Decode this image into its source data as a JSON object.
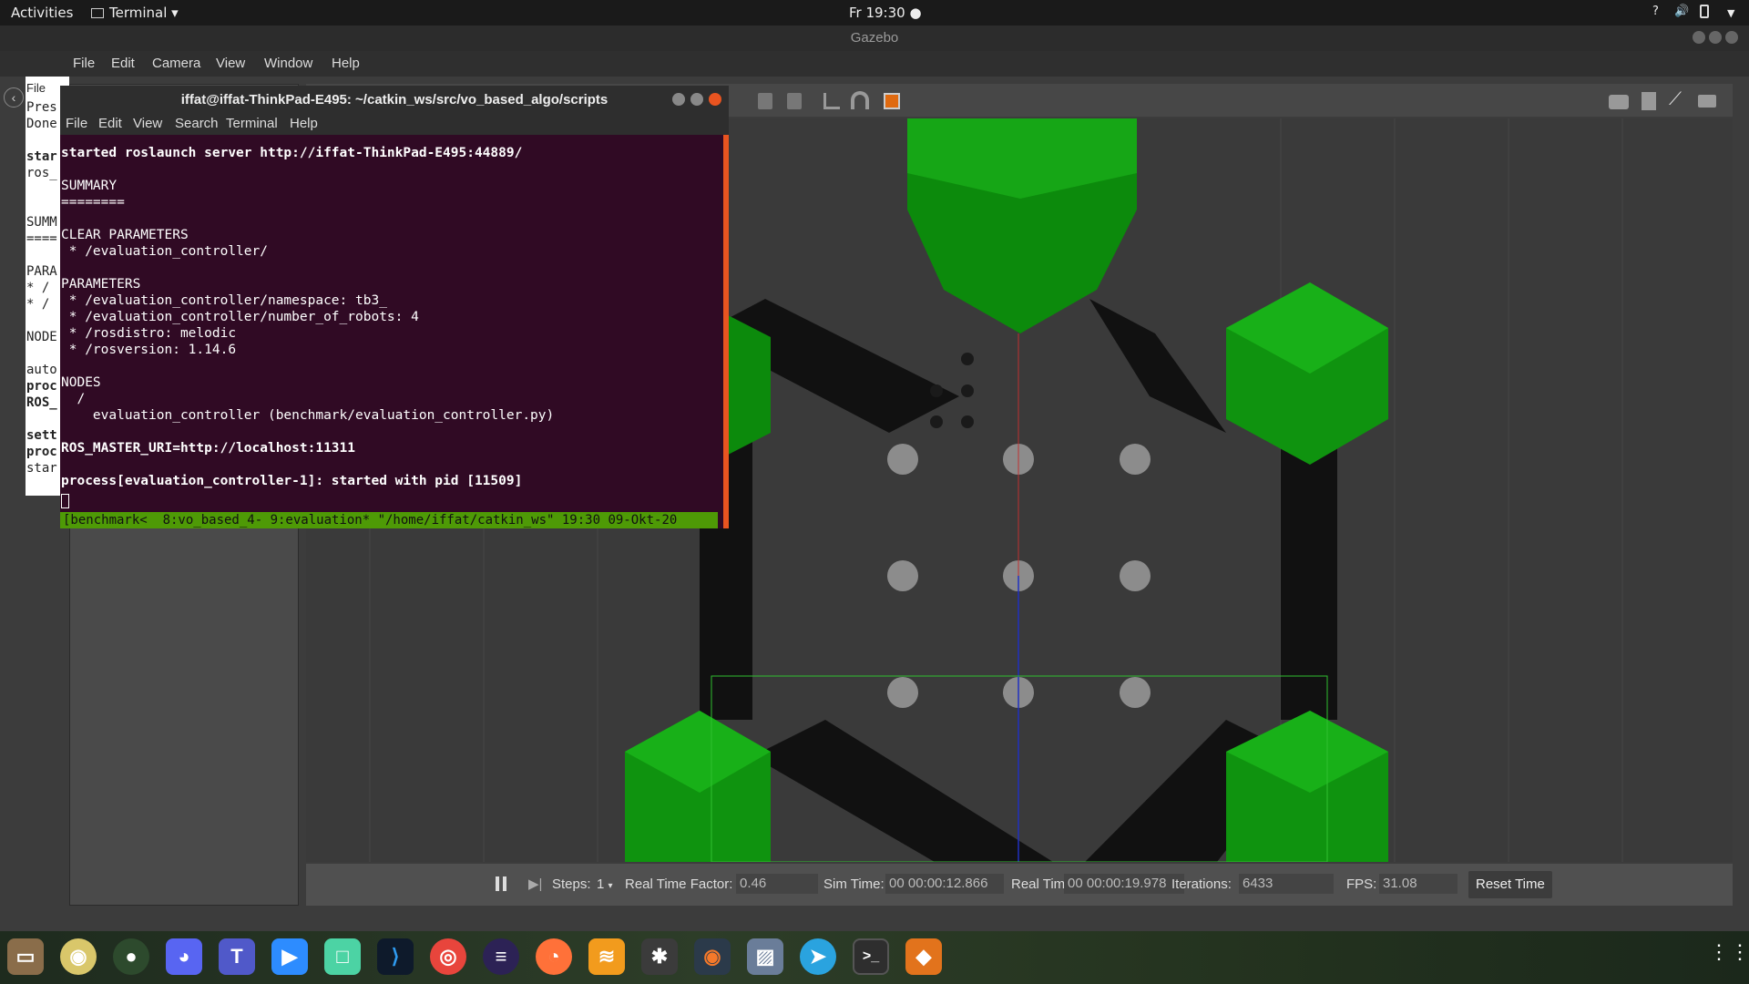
{
  "topbar": {
    "activities": "Activities",
    "app_menu": "Terminal",
    "clock": "Fr 19:30",
    "help": "?"
  },
  "gazebo": {
    "title": "Gazebo",
    "menu": [
      "File",
      "Edit",
      "Camera",
      "View",
      "Window",
      "Help"
    ],
    "bottombar": {
      "steps_label": "Steps:",
      "steps_value": "1",
      "rtf_label": "Real Time Factor:",
      "rtf_value": "0.46",
      "sim_time_label": "Sim Time:",
      "sim_time_value": "00 00:00:12.866",
      "real_time_label": "Real Time:",
      "real_time_value": "00 00:00:19.978",
      "iterations_label": "Iterations:",
      "iterations_value": "6433",
      "fps_label": "FPS:",
      "fps_value": "31.08",
      "reset_time": "Reset Time"
    }
  },
  "back_terminal": {
    "menu_file": "File",
    "lines": [
      "Pres",
      "Done",
      "",
      "star",
      "ros_",
      "",
      "SUMM",
      "====",
      "",
      "PARA",
      " * /",
      " * /",
      "",
      "NODE",
      "",
      "auto",
      "proc",
      "ROS_",
      "",
      "sett",
      "proc",
      "star"
    ]
  },
  "terminal": {
    "title": "iffat@iffat-ThinkPad-E495: ~/catkin_ws/src/vo_based_algo/scripts",
    "menu": [
      "File",
      "Edit",
      "View",
      "Search",
      "Terminal",
      "Help"
    ],
    "lines": [
      "started roslaunch server http://iffat-ThinkPad-E495:44889/",
      "",
      "SUMMARY",
      "========",
      "",
      "CLEAR PARAMETERS",
      " * /evaluation_controller/",
      "",
      "PARAMETERS",
      " * /evaluation_controller/namespace: tb3_",
      " * /evaluation_controller/number_of_robots: 4",
      " * /rosdistro: melodic",
      " * /rosversion: 1.14.6",
      "",
      "NODES",
      "  /",
      "    evaluation_controller (benchmark/evaluation_controller.py)",
      "",
      "ROS_MASTER_URI=http://localhost:11311",
      "",
      "process[evaluation_controller-1]: started with pid [11509]"
    ],
    "tmux_status": "[benchmark<  8:vo_based_4- 9:evaluation* \"/home/iffat/catkin_ws\" 19:30 09-Okt-20"
  },
  "colors": {
    "terminal_bg": "#300a24",
    "tmux_green": "#4e9a06",
    "hex_green": "#0f9a0f",
    "wall_black": "#111111",
    "ground": "#3a3a3a"
  },
  "dock": [
    {
      "name": "files-icon"
    },
    {
      "name": "rhythmbox-icon"
    },
    {
      "name": "gimp-icon"
    },
    {
      "name": "discord-icon"
    },
    {
      "name": "teams-icon"
    },
    {
      "name": "zoom-icon"
    },
    {
      "name": "notes-icon"
    },
    {
      "name": "vscode-icon"
    },
    {
      "name": "chrome-icon"
    },
    {
      "name": "eclipse-icon"
    },
    {
      "name": "firefox-icon"
    },
    {
      "name": "books-icon"
    },
    {
      "name": "rviz-icon"
    },
    {
      "name": "blender-icon"
    },
    {
      "name": "image-viewer-icon"
    },
    {
      "name": "telegram-icon"
    },
    {
      "name": "terminal-icon"
    },
    {
      "name": "update-icon"
    }
  ]
}
